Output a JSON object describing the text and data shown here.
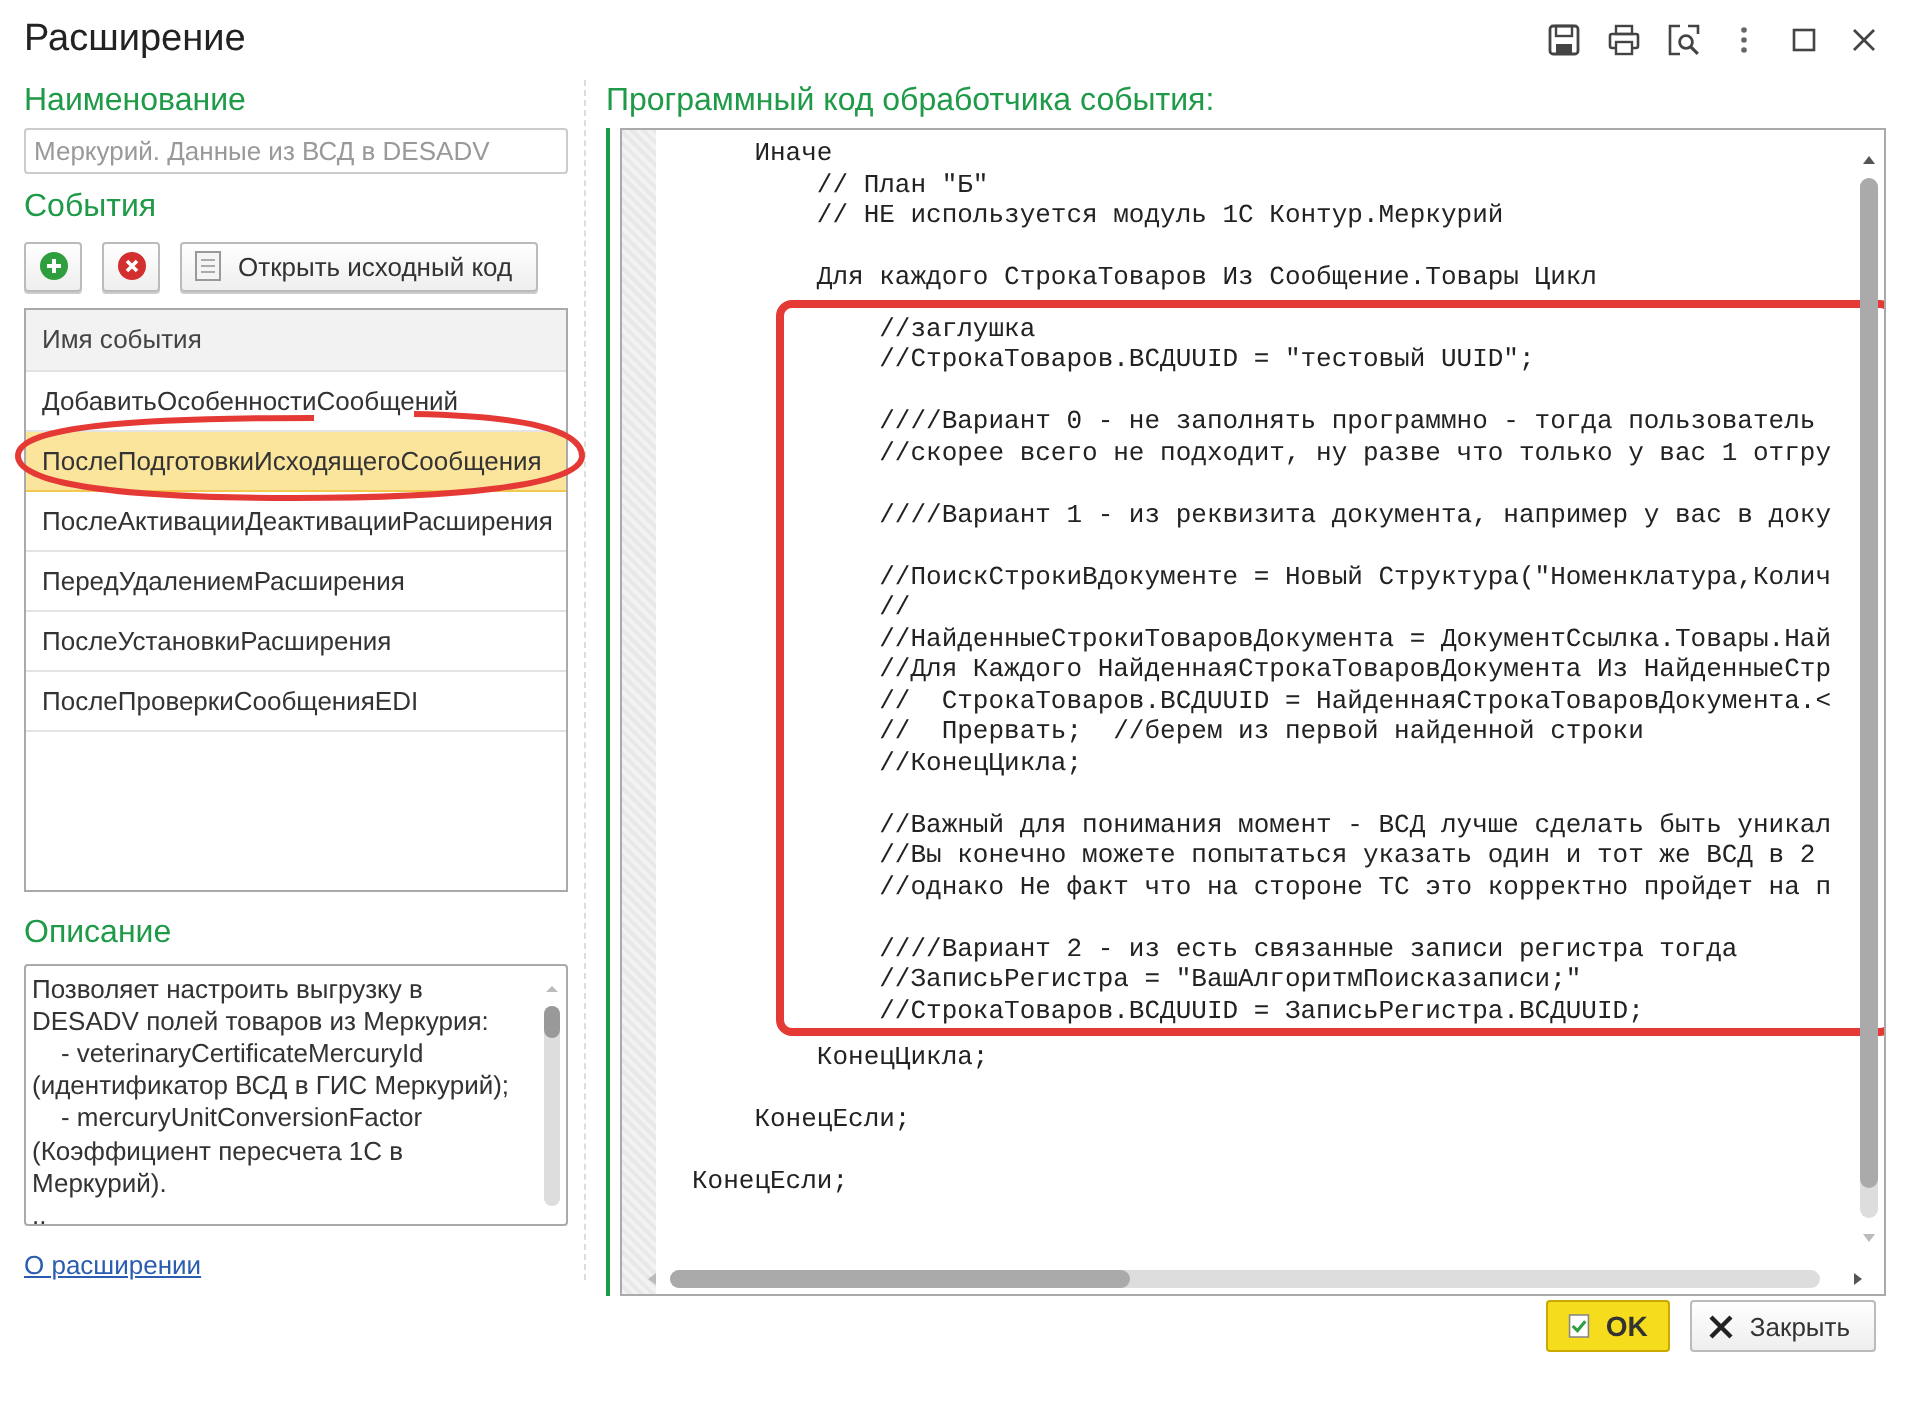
{
  "window": {
    "title": "Расширение"
  },
  "name_section": {
    "label": "Наименование",
    "placeholder": "Меркурий. Данные из ВСД в DESADV"
  },
  "events_section": {
    "label": "События",
    "open_code_button": "Открыть исходный код"
  },
  "events_table": {
    "column": "Имя события",
    "rows": [
      {
        "name": "ДобавитьОсобенностиСообщений",
        "selected": false
      },
      {
        "name": "ПослеПодготовкиИсходящегоСообщения",
        "selected": true
      },
      {
        "name": "ПослеАктивацииДеактивацииРасширения",
        "selected": false
      },
      {
        "name": "ПередУдалениемРасширения",
        "selected": false
      },
      {
        "name": "ПослеУстановкиРасширения",
        "selected": false
      },
      {
        "name": "ПослеПроверкиСообщенияEDI",
        "selected": false
      }
    ]
  },
  "description": {
    "label": "Описание",
    "text": "Позволяет настроить выгрузку в DESADV полей товаров из Меркурия:\n    - veterinaryCertificateMercuryId (идентификатор ВСД в ГИС Меркурий);\n    - mercuryUnitConversionFactor (Коэффициент пересчета 1С в Меркурий).\n.."
  },
  "about_link": "О расширении",
  "code": {
    "label": "Программный код обработчика события:",
    "blocks": [
      {
        "marked": false,
        "paragraphs": [
          [
            "    Иначе",
            "        // План \"Б\"",
            "        // НЕ используется модуль 1С Контур.Меркурий"
          ],
          [
            "        Для каждого СтрокаТоваров Из Сообщение.Товары Цикл"
          ]
        ]
      },
      {
        "marked": true,
        "paragraphs": [
          [
            "            //заглушка",
            "            //СтрокаТоваров.ВСДUUID = \"тестовый UUID\";"
          ],
          [
            "            ////Вариант 0 - не заполнять программно - тогда пользователь",
            "            //скорее всего не подходит, ну разве что только у вас 1 отгру"
          ],
          [
            "            ////Вариант 1 - из реквизита документа, например у вас в доку"
          ],
          [
            "            //ПоискСтрокиВдокументе = Новый Структура(\"Номенклатура,Колич",
            "            //",
            "            //НайденныеСтрокиТоваровДокумента = ДокументСсылка.Товары.Най",
            "            //Для Каждого НайденнаяСтрокаТоваровДокумента Из НайденныеСтр",
            "            //  СтрокаТоваров.ВСДUUID = НайденнаяСтрокаТоваровДокумента.<",
            "            //  Прервать;  //берем из первой найденной строки",
            "            //КонецЦикла;"
          ],
          [
            "            //Важный для понимания момент - ВСД лучше сделать быть уникал",
            "            //Вы конечно можете попытаться указать один и тот же ВСД в 2",
            "            //однако Не факт что на стороне ТС это корректно пройдет на п"
          ],
          [
            "            ////Вариант 2 - из есть связанные записи регистра тогда",
            "            //ЗаписьРегистра = \"ВашАлгоритмПоисказаписи;\"",
            "            //СтрокаТоваров.ВСДUUID = ЗаписьРегистра.ВСДUUID;"
          ]
        ]
      },
      {
        "marked": false,
        "paragraphs": [
          [
            "        КонецЦикла;"
          ],
          [
            "    КонецЕсли;"
          ],
          [
            "КонецЕсли;"
          ]
        ]
      }
    ]
  },
  "buttons": {
    "ok": "OK",
    "close": "Закрыть"
  }
}
